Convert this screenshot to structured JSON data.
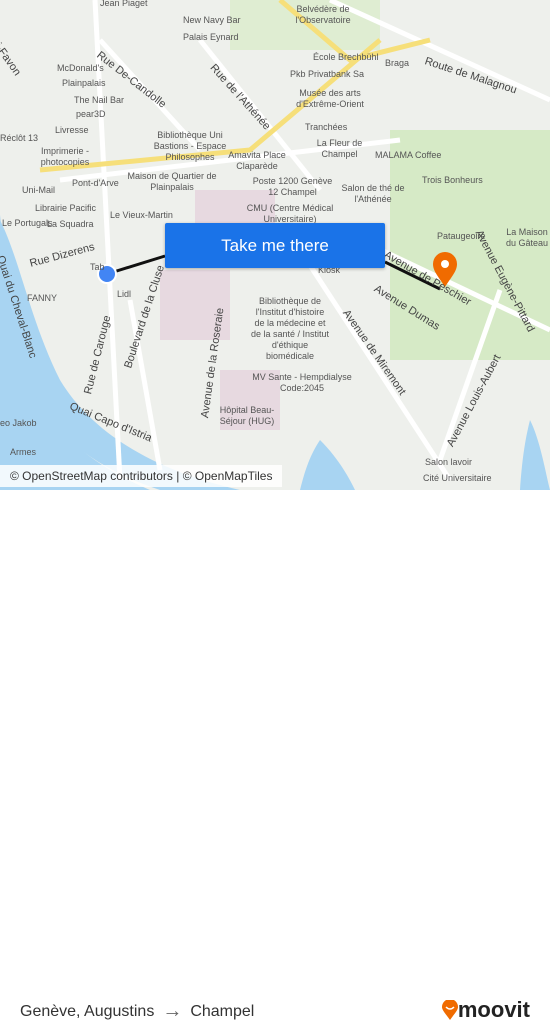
{
  "map": {
    "cta_label": "Take me there",
    "attribution": "© OpenStreetMap contributors | © OpenMapTiles",
    "labels": [
      "Jean Piaget",
      "New Navy Bar",
      "Belvédère de l'Observatoire",
      "Palais Eynard",
      "McDonald's",
      "Plainpalais",
      "The Nail Bar",
      "pear3D",
      "Livresse",
      "Imprimerie - photocopies",
      "Uni-Mail",
      "Pont-d'Arve",
      "Librairie Pacific",
      "Le Portugals",
      "La Squadra",
      "Le Vieux-Martin",
      "Maison de Quartier de Plainpalais",
      "Bibliothèque Uni Bastions - Espace Philosophes",
      "Amavita Place Claparède",
      "Poste 1200 Genève 12 Champel",
      "CMU (Centre Médical Universitaire)",
      "École Brechbühl",
      "Pkb Privatbank Sa",
      "Musée des arts d'Extrême-Orient",
      "Tranchées",
      "La Fleur de Champel",
      "MALAMA Coffee",
      "Salon de thé de l'Athénée",
      "Braga",
      "Trois Bonheurs",
      "Pataugeoire",
      "La Maison du Gâteau",
      "Bibliothèque de l'Institut d'histoire de la médecine et de la santé / Institut d'éthique biomédicale",
      "MV Sante - Hempdialyse Code:2045",
      "Hôpital Beau-Séjour (HUG)",
      "Salon lavoir",
      "Cité Universitaire",
      "FANNY",
      "Lidl",
      "Armes",
      "eo Jakob",
      "Kiosk",
      "Réclôt 13",
      "Tab"
    ],
    "streets": [
      "Rue De-Candolle",
      "Rue de l'Athénée",
      "Route de Malagnou",
      "Rue Dizerens",
      "Rue de Carouge",
      "Boulevard de la Cluse",
      "Avenue de la Roseraie",
      "Quai du Cheval-Blanc",
      "Quai Capo d'Istria",
      "Avenue Dumas",
      "Avenue de Miremont",
      "Avenue Louis-Aubert",
      "Avenue Eugène-Pittard",
      "Avenue de Peschier",
      "Rue Henri-Favon"
    ],
    "colors": {
      "route": "#111111",
      "origin": "#4285f4",
      "destination": "#f06b00",
      "button": "#1a73e8"
    }
  },
  "footer": {
    "origin": "Genève, Augustins",
    "destination": "Champel",
    "arrow": "→",
    "brand": "moovit"
  }
}
